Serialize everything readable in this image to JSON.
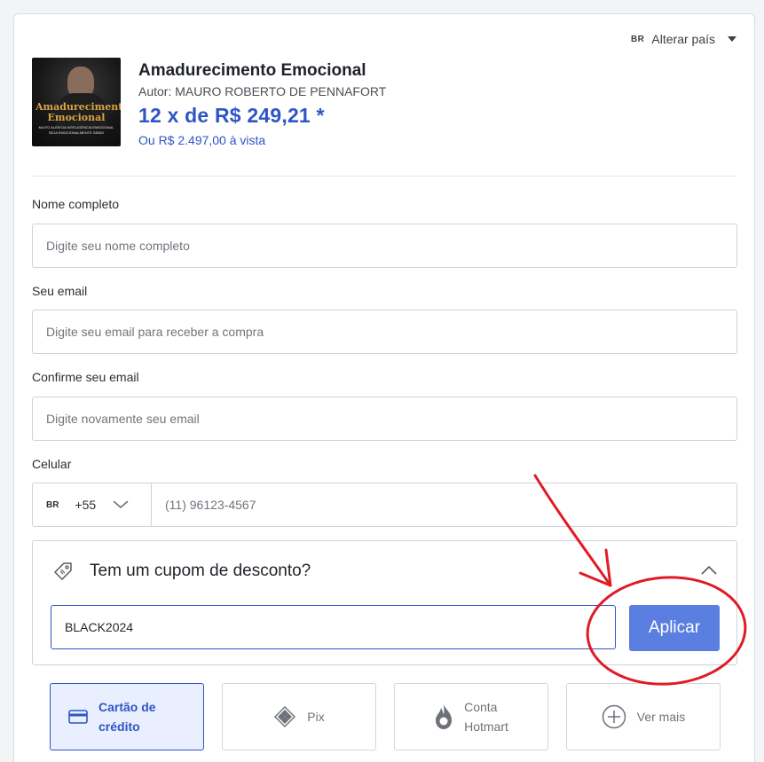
{
  "header": {
    "country_flag": "BR",
    "country_label": "Alterar país"
  },
  "product": {
    "image_title": "Amadurecimento Emocional",
    "image_subtitle": "MUITO ALÉM DA INTELIGÊNCIA EMOCIONAL",
    "image_tagline": "SEJA EMOCIONALMENTE SÁBIO",
    "title": "Amadurecimento Emocional",
    "author": "Autor: MAURO ROBERTO DE PENNAFORT",
    "installment_price": "12 x de R$ 249,21 *",
    "cash_price": "Ou R$ 2.497,00 à vista"
  },
  "form": {
    "name": {
      "label": "Nome completo",
      "placeholder": "Digite seu nome completo",
      "value": ""
    },
    "email": {
      "label": "Seu email",
      "placeholder": "Digite seu email para receber a compra",
      "value": ""
    },
    "confirm_email": {
      "label": "Confirme seu email",
      "placeholder": "Digite novamente seu email",
      "value": ""
    },
    "phone": {
      "label": "Celular",
      "country_flag": "BR",
      "country_code": "+55",
      "placeholder": "(11) 96123-4567",
      "value": ""
    }
  },
  "coupon": {
    "title": "Tem um cupom de desconto?",
    "value": "BLACK2024",
    "apply_label": "Aplicar",
    "expanded": true
  },
  "payment_methods": [
    {
      "label_line1": "Cartão de",
      "label_line2": "crédito",
      "icon": "credit-card-icon",
      "selected": true
    },
    {
      "label_line1": "Pix",
      "label_line2": "",
      "icon": "pix-icon",
      "selected": false
    },
    {
      "label_line1": "Conta",
      "label_line2": "Hotmart",
      "icon": "hotmart-flame-icon",
      "selected": false
    },
    {
      "label_line1": "Ver mais",
      "label_line2": "",
      "icon": "plus-circle-icon",
      "selected": false
    }
  ],
  "colors": {
    "accent": "#2f55c4",
    "button": "#5b7fe0",
    "annotation": "#e01b24"
  }
}
